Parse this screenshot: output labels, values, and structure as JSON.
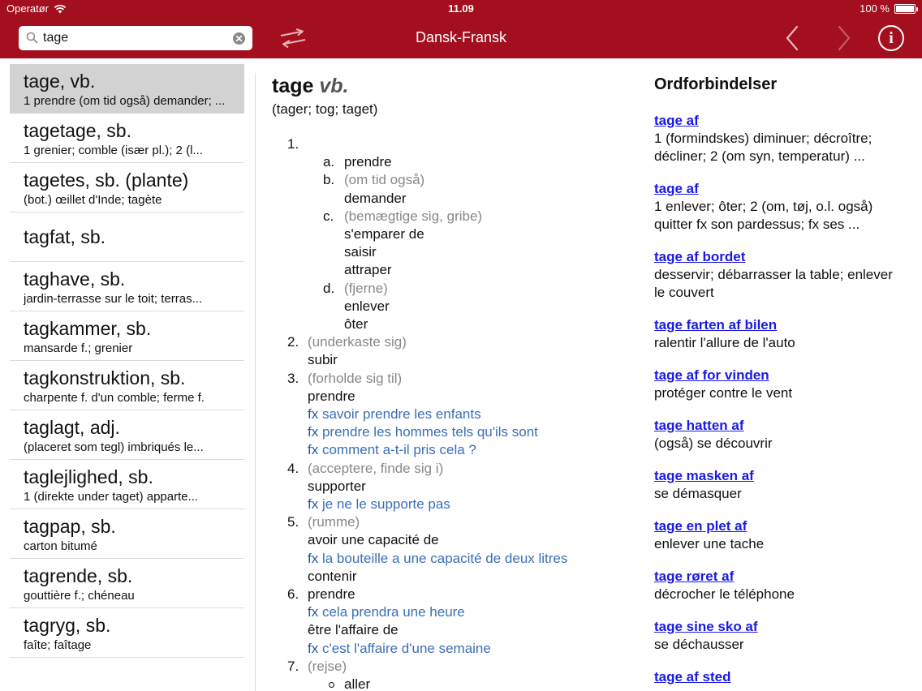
{
  "status": {
    "carrier": "Operatør",
    "time": "11.09",
    "battery_text": "100 %",
    "battery_level": 1.0
  },
  "toolbar": {
    "search_value": "tage",
    "title": "Dansk-Fransk",
    "info_label": "i"
  },
  "list": [
    {
      "head": "tage, vb.",
      "sub": "1 prendre (om tid også) demander; ..."
    },
    {
      "head": "tagetage, sb.",
      "sub": "1 grenier; comble (især pl.); 2 (l..."
    },
    {
      "head": "tagetes, sb. (plante)",
      "sub": "(bot.) œillet d'Inde; tagète"
    },
    {
      "head": "tagfat, sb.",
      "sub": ""
    },
    {
      "head": "taghave, sb.",
      "sub": "jardin-terrasse sur le toit; terras..."
    },
    {
      "head": "tagkammer, sb.",
      "sub": "mansarde f.; grenier"
    },
    {
      "head": "tagkonstruktion, sb.",
      "sub": "charpente f. d'un comble; ferme f."
    },
    {
      "head": "taglagt, adj.",
      "sub": "(placeret som tegl) imbriqués le..."
    },
    {
      "head": "taglejlighed, sb.",
      "sub": "1 (direkte under taget) apparte..."
    },
    {
      "head": "tagpap, sb.",
      "sub": "carton bitumé"
    },
    {
      "head": "tagrende, sb.",
      "sub": "gouttière f.; chéneau"
    },
    {
      "head": "tagryg, sb.",
      "sub": "faîte; faîtage"
    }
  ],
  "entry": {
    "headword": "tage",
    "pos": "vb.",
    "forms": "(tager; tog; taget)",
    "lines": [
      {
        "num": "1.",
        "text": ""
      },
      {
        "num": "a.",
        "text": "prendre"
      },
      {
        "num": "b.",
        "text": "(om tid også)",
        "style": "gray"
      },
      {
        "num": "",
        "text": "demander"
      },
      {
        "num": "c.",
        "text": "(bemægtige sig, gribe)",
        "style": "gray"
      },
      {
        "num": "",
        "text": "s'emparer de"
      },
      {
        "num": "",
        "text": "saisir"
      },
      {
        "num": "",
        "text": "attraper"
      },
      {
        "num": "d.",
        "text": "(fjerne)",
        "style": "gray"
      },
      {
        "num": "",
        "text": "enlever"
      },
      {
        "num": "",
        "text": "ôter"
      },
      {
        "num": "2.",
        "text": "(underkaste sig)",
        "style": "gray"
      },
      {
        "num": "",
        "text": "subir"
      },
      {
        "num": "3.",
        "text": "(forholde sig til)",
        "style": "gray"
      },
      {
        "num": "",
        "text": "prendre"
      },
      {
        "num": "",
        "fx": "fx",
        "text": "savoir prendre les enfants",
        "style": "blue"
      },
      {
        "num": "",
        "fx": "fx",
        "text": "prendre les hommes tels qu'ils sont",
        "style": "blue"
      },
      {
        "num": "",
        "fx": "fx",
        "text": "comment a-t-il pris cela ?",
        "style": "blue"
      },
      {
        "num": "4.",
        "text": "(acceptere, finde sig i)",
        "style": "gray"
      },
      {
        "num": "",
        "text": "supporter"
      },
      {
        "num": "",
        "fx": "fx",
        "text": "je ne le supporte pas",
        "style": "blue"
      },
      {
        "num": "5.",
        "text": "(rumme)",
        "style": "gray"
      },
      {
        "num": "",
        "text": "avoir une capacité de"
      },
      {
        "num": "",
        "fx": "fx",
        "text": "la bouteille a une capacité de deux litres",
        "style": "blue"
      },
      {
        "num": "",
        "text": "contenir"
      },
      {
        "num": "6.",
        "text": "prendre"
      },
      {
        "num": "",
        "fx": "fx",
        "text": "cela prendra une heure",
        "style": "blue"
      },
      {
        "num": "",
        "text": "être l'affaire de"
      },
      {
        "num": "",
        "fx": "fx",
        "text": "c'est l'affaire d'une semaine",
        "style": "blue"
      },
      {
        "num": "7.",
        "text": "(rejse)",
        "style": "gray"
      },
      {
        "num": "",
        "text": "aller",
        "bullet": true
      }
    ]
  },
  "phrases": {
    "title": "Ordforbindelser",
    "items": [
      {
        "link": "tage af",
        "lines": [
          "1 (formindskes) diminuer; décroître;",
          "décliner; 2 (om syn, temperatur) ..."
        ]
      },
      {
        "link": "tage af",
        "lines": [
          "1 enlever; ôter; 2 (om, tøj, o.l. også)",
          "quitter fx son pardessus; fx ses ..."
        ]
      },
      {
        "link": "tage af bordet",
        "lines": [
          "desservir; débarrasser la table; enlever",
          "le couvert"
        ]
      },
      {
        "link": "tage farten af bilen",
        "lines": [
          "ralentir l'allure de l'auto"
        ]
      },
      {
        "link": "tage af for vinden",
        "lines": [
          "protéger contre le vent"
        ]
      },
      {
        "link": "tage hatten af",
        "lines": [
          "(også) se découvrir"
        ]
      },
      {
        "link": "tage masken af",
        "lines": [
          "se démasquer"
        ]
      },
      {
        "link": "tage en plet af",
        "lines": [
          "enlever une tache"
        ]
      },
      {
        "link": "tage røret af",
        "lines": [
          "décrocher le téléphone"
        ]
      },
      {
        "link": "tage sine sko af",
        "lines": [
          "se déchausser"
        ]
      },
      {
        "link": "tage af sted",
        "lines": []
      }
    ]
  }
}
